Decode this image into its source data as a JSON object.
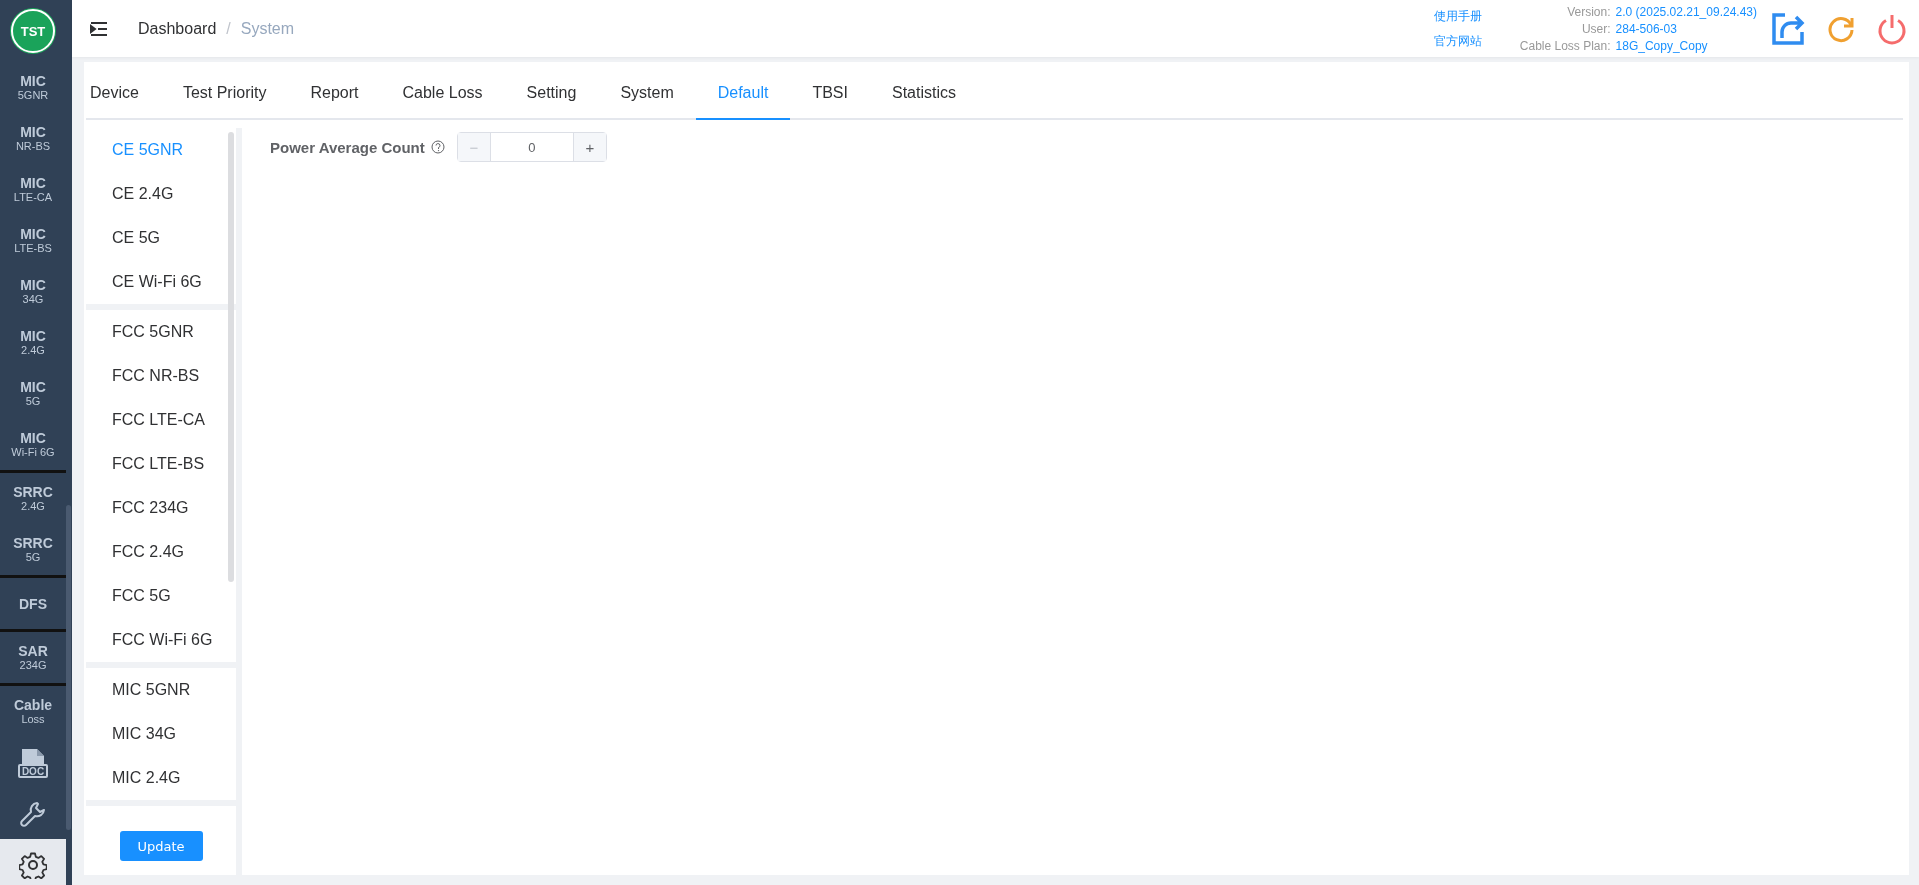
{
  "sidebar": {
    "logo": "TST",
    "groups": [
      {
        "items": [
          {
            "kind": "text",
            "title": "MIC",
            "subtitle": "5GNR",
            "selected": false
          },
          {
            "kind": "text",
            "title": "MIC",
            "subtitle": "NR-BS",
            "selected": false
          },
          {
            "kind": "text",
            "title": "MIC",
            "subtitle": "LTE-CA",
            "selected": false
          },
          {
            "kind": "text",
            "title": "MIC",
            "subtitle": "LTE-BS",
            "selected": false
          },
          {
            "kind": "text",
            "title": "MIC",
            "subtitle": "34G",
            "selected": false
          },
          {
            "kind": "text",
            "title": "MIC",
            "subtitle": "2.4G",
            "selected": false
          },
          {
            "kind": "text",
            "title": "MIC",
            "subtitle": "5G",
            "selected": false
          },
          {
            "kind": "text",
            "title": "MIC",
            "subtitle": "Wi-Fi 6G",
            "selected": false
          }
        ]
      },
      {
        "items": [
          {
            "kind": "text",
            "title": "SRRC",
            "subtitle": "2.4G",
            "selected": false
          },
          {
            "kind": "text",
            "title": "SRRC",
            "subtitle": "5G",
            "selected": false
          }
        ]
      },
      {
        "items": [
          {
            "kind": "text",
            "title": "DFS",
            "selected": false
          }
        ]
      },
      {
        "items": [
          {
            "kind": "text",
            "title": "SAR",
            "subtitle": "234G",
            "selected": false
          }
        ]
      },
      {
        "items": [
          {
            "kind": "text",
            "title": "Cable",
            "subtitle": "Loss",
            "selected": false
          },
          {
            "kind": "doc",
            "label": "DOC",
            "selected": false
          },
          {
            "kind": "wrench",
            "selected": false
          },
          {
            "kind": "gear",
            "selected": true
          }
        ]
      }
    ]
  },
  "header": {
    "breadcrumb": [
      "Dashboard",
      "System"
    ],
    "separator": "/",
    "links": [
      "使用手册",
      "官方网站"
    ],
    "info": [
      {
        "label": "Version:",
        "value": "2.0 (2025.02.21_09.24.43)"
      },
      {
        "label": "User:",
        "value": "284-506-03"
      },
      {
        "label": "Cable Loss Plan:",
        "value": "18G_Copy_Copy"
      }
    ]
  },
  "tabs": [
    {
      "label": "Device",
      "selected": false
    },
    {
      "label": "Test Priority",
      "selected": false
    },
    {
      "label": "Report",
      "selected": false
    },
    {
      "label": "Cable Loss",
      "selected": false
    },
    {
      "label": "Setting",
      "selected": false
    },
    {
      "label": "System",
      "selected": false
    },
    {
      "label": "Default",
      "selected": true
    },
    {
      "label": "TBSI",
      "selected": false
    },
    {
      "label": "Statistics",
      "selected": false
    }
  ],
  "list": {
    "groups": [
      {
        "items": [
          {
            "label": "CE 5GNR",
            "selected": true
          },
          {
            "label": "CE 2.4G",
            "selected": false
          },
          {
            "label": "CE 5G",
            "selected": false
          },
          {
            "label": "CE Wi-Fi 6G",
            "selected": false
          }
        ]
      },
      {
        "items": [
          {
            "label": "FCC 5GNR",
            "selected": false
          },
          {
            "label": "FCC NR-BS",
            "selected": false
          },
          {
            "label": "FCC LTE-CA",
            "selected": false
          },
          {
            "label": "FCC LTE-BS",
            "selected": false
          },
          {
            "label": "FCC 234G",
            "selected": false
          },
          {
            "label": "FCC 2.4G",
            "selected": false
          },
          {
            "label": "FCC 5G",
            "selected": false
          },
          {
            "label": "FCC Wi-Fi 6G",
            "selected": false
          }
        ]
      },
      {
        "items": [
          {
            "label": "MIC 5GNR",
            "selected": false
          },
          {
            "label": "MIC 34G",
            "selected": false
          },
          {
            "label": "MIC 2.4G",
            "selected": false
          }
        ]
      }
    ],
    "button": "Update"
  },
  "form": {
    "label": "Power Average Count",
    "value": "0",
    "minus_disabled": true,
    "minus": "−",
    "plus": "+"
  }
}
